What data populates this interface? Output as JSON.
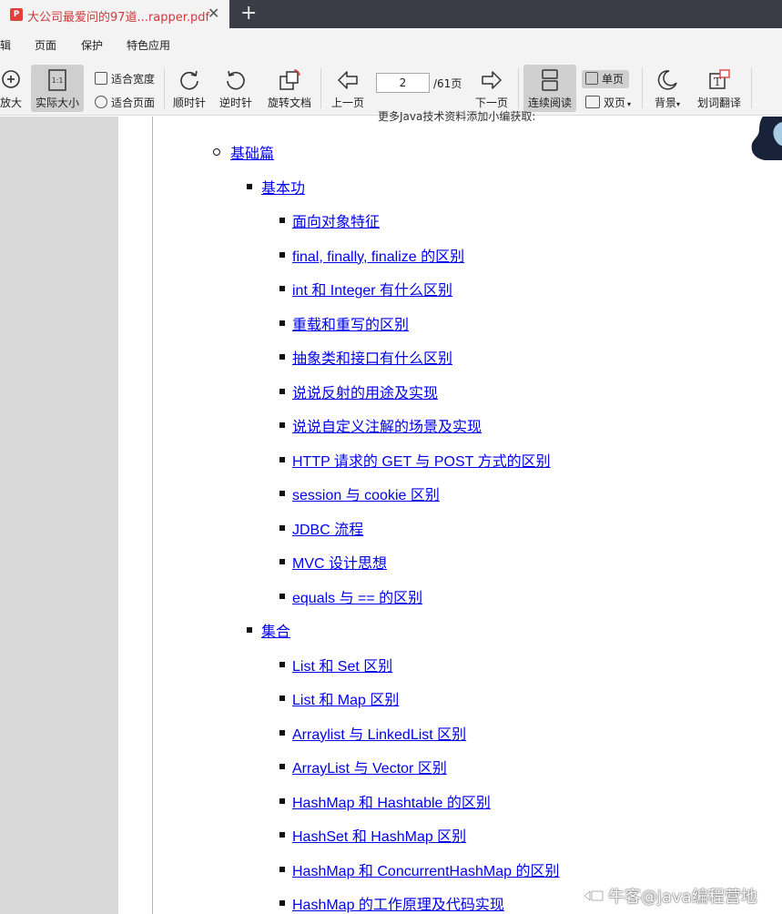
{
  "tab": {
    "title": "大公司最爱问的97道...rapper.pdf",
    "pdf_icon": "P",
    "close": "✕",
    "new_tab": "+"
  },
  "menu": {
    "items": [
      "辑",
      "页面",
      "保护",
      "特色应用"
    ]
  },
  "toolbar": {
    "zoom_in": "放大",
    "actual_size": "实际大小",
    "actual_size_icon": "1:1",
    "fit_width": "适合宽度",
    "fit_page": "适合页面",
    "rotate_cw": "顺时针",
    "rotate_ccw": "逆时针",
    "rotate_doc": "旋转文档",
    "prev_page": "上一页",
    "page_current": "2",
    "page_total": "/61页",
    "next_page": "下一页",
    "continuous": "连续阅读",
    "single_page": "单页",
    "double_page": "双页",
    "background": "背景",
    "translate": "划词翻译"
  },
  "document": {
    "cut_text": "更多Java技术资料添加小编获取:",
    "toc": {
      "section": "基础篇",
      "groups": [
        {
          "title": "基本功",
          "items": [
            "面向对象特征",
            "final, finally, finalize 的区别",
            "int 和 Integer 有什么区别",
            "重载和重写的区别",
            "抽象类和接口有什么区别",
            "说说反射的用途及实现",
            "说说自定义注解的场景及实现",
            "HTTP 请求的 GET 与 POST 方式的区别",
            "session 与 cookie 区别",
            "JDBC 流程",
            "MVC 设计思想",
            "equals 与 == 的区别"
          ]
        },
        {
          "title": "集合",
          "items": [
            "List 和 Set 区别",
            "List 和 Map 区别",
            "Arraylist 与 LinkedList 区别",
            "ArrayList 与 Vector 区别",
            "HashMap 和 Hashtable 的区别",
            "HashSet 和 HashMap 区别",
            "HashMap 和 ConcurrentHashMap 的区别",
            "HashMap 的工作原理及代码实现"
          ]
        }
      ]
    }
  },
  "watermark": "牛客@java编程营地",
  "icons": {
    "zoom_in": "zoom-in-icon",
    "rotate_cw": "rotate-clockwise-icon",
    "rotate_ccw": "rotate-counterclockwise-icon",
    "prev": "arrow-left-icon",
    "next": "arrow-right-icon",
    "continuous": "continuous-read-icon",
    "background": "moon-icon",
    "translate": "translate-icon"
  },
  "colors": {
    "tab_title": "#d0393a",
    "link": "#0000ee",
    "tabbar": "#3a3d45",
    "toolbar": "#f3f3f3"
  }
}
